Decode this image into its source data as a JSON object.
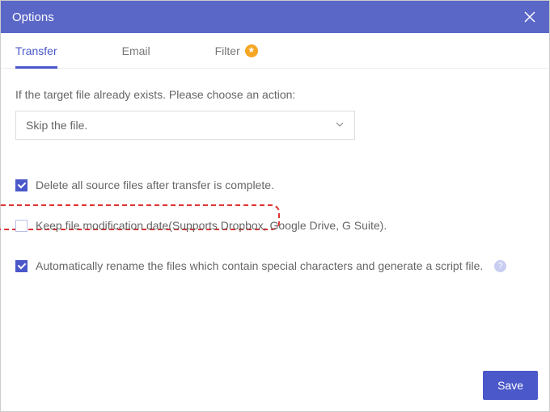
{
  "window": {
    "title": "Options"
  },
  "tabs": {
    "transfer": "Transfer",
    "email": "Email",
    "filter": "Filter"
  },
  "form": {
    "existsPrompt": "If the target file already exists. Please choose an action:",
    "selected": "Skip the file.",
    "opt_delete": "Delete all source files after transfer is complete.",
    "opt_keepdate": "Keep file modification date(Supports Dropbox, Google Drive, G Suite).",
    "opt_rename": "Automatically rename the files which contain special characters and generate a script file."
  },
  "buttons": {
    "save": "Save"
  }
}
